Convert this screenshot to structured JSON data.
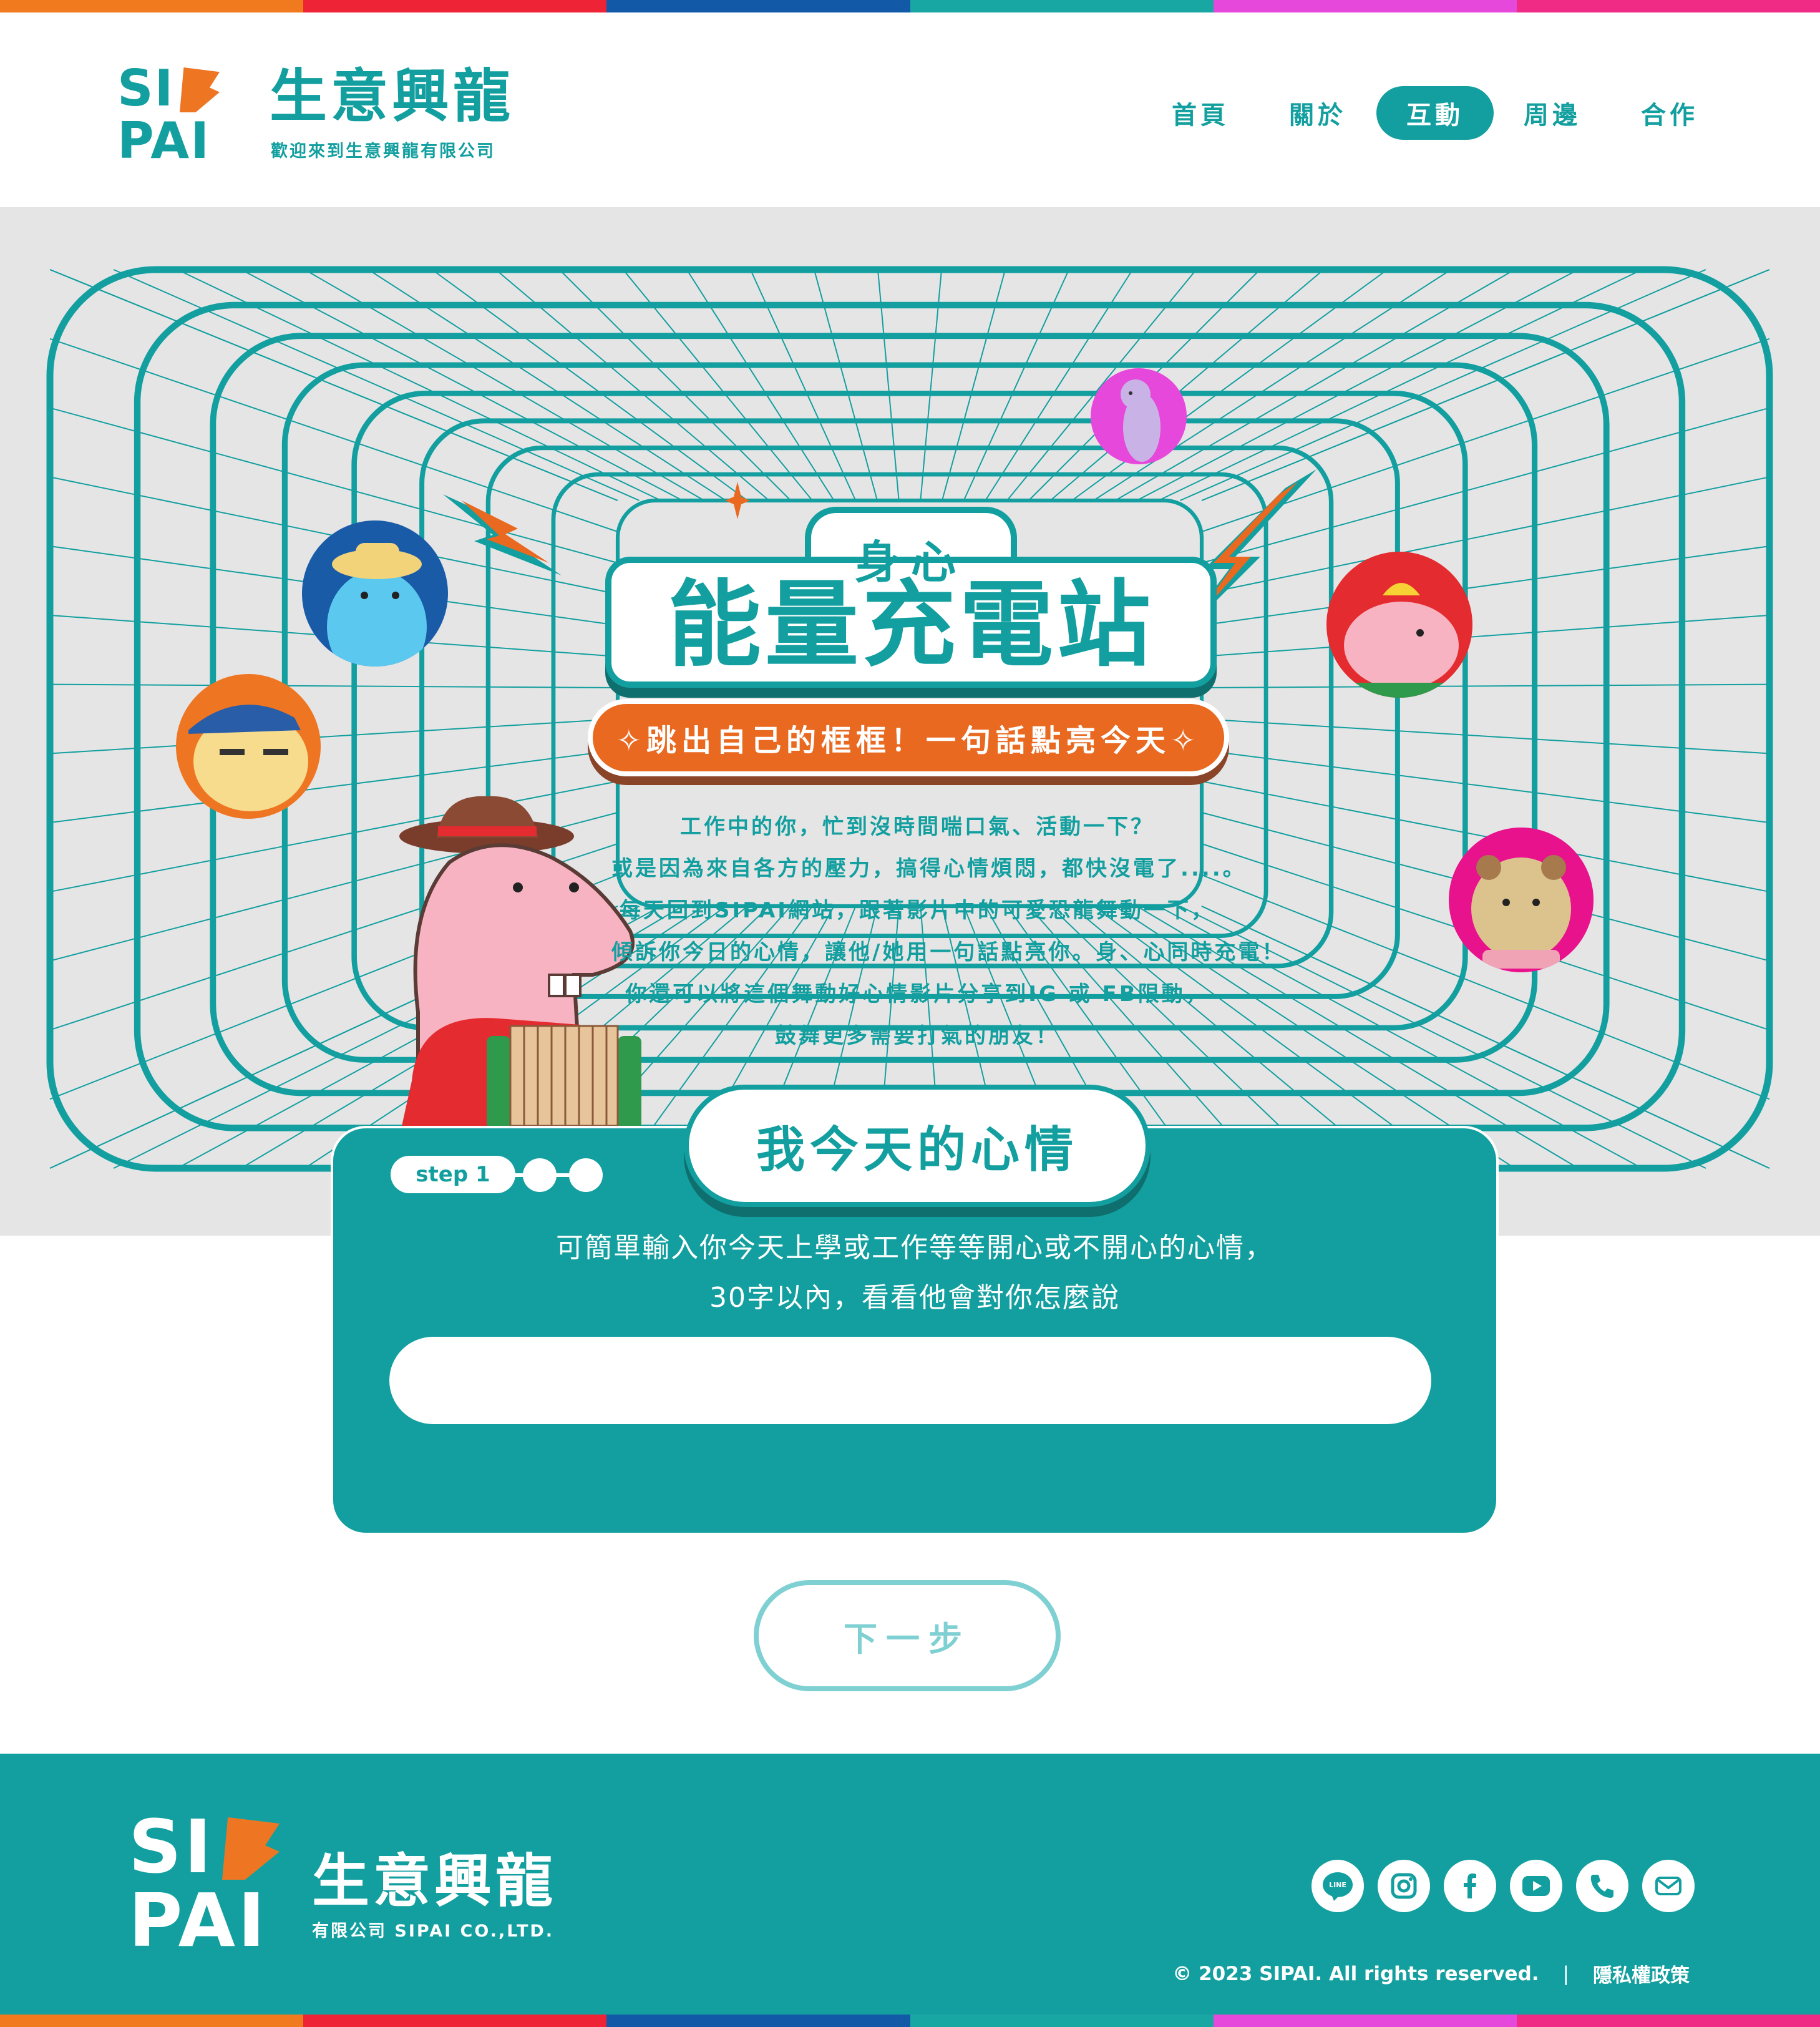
{
  "stripe_colors": [
    "#f07a1d",
    "#ee2336",
    "#1259a8",
    "#19a7a4",
    "#e548da",
    "#f02b86"
  ],
  "brand": {
    "logo_text_1": "SI",
    "logo_text_2": "PAI",
    "title": "生意興龍",
    "subtitle": "歡迎來到生意興龍有限公司",
    "primary_color": "#139f9f",
    "accent_color": "#ee7623"
  },
  "nav": {
    "items": [
      {
        "label": "首頁",
        "active": false
      },
      {
        "label": "關於",
        "active": false
      },
      {
        "label": "互動",
        "active": true
      },
      {
        "label": "周邊",
        "active": false
      },
      {
        "label": "合作",
        "active": false
      }
    ]
  },
  "hero": {
    "title_small": "身心",
    "title_big": "能量充電站",
    "slogan": "✧跳出自己的框框！一句話點亮今天✧",
    "intro_lines": [
      "工作中的你，忙到沒時間喘口氣、活動一下？",
      "或是因為來自各方的壓力，搞得心情煩悶，都快沒電了....。",
      "每天回到SIPAI網站，跟著影片中的可愛恐龍舞動一下，",
      "傾訴你今日的心情，讓他/她用一句話點亮你。身、心同時充電！",
      "你還可以將這個舞動好心情影片分享到IG 或 FB限動，",
      "鼓舞更多需要打氣的朋友！"
    ]
  },
  "step_card": {
    "step_label": "step 1",
    "title": "我今天的心情",
    "description_lines": [
      "可簡單輸入你今天上學或工作等等開心或不開心的心情，",
      "30字以內，看看他會對你怎麼說"
    ],
    "input_value": "",
    "input_placeholder": ""
  },
  "next_button": {
    "label": "下一步"
  },
  "footer": {
    "logo_text_1": "SI",
    "logo_text_2": "PAI",
    "title": "生意興龍",
    "subtitle": "有限公司 SIPAI CO.,LTD.",
    "social_icons": [
      "line-icon",
      "instagram-icon",
      "facebook-icon",
      "youtube-icon",
      "phone-icon",
      "mail-icon"
    ],
    "line_label": "LINE",
    "copyright": "© 2023 SIPAI. All rights reserved.",
    "separator": "|",
    "privacy_label": "隱私權政策"
  }
}
